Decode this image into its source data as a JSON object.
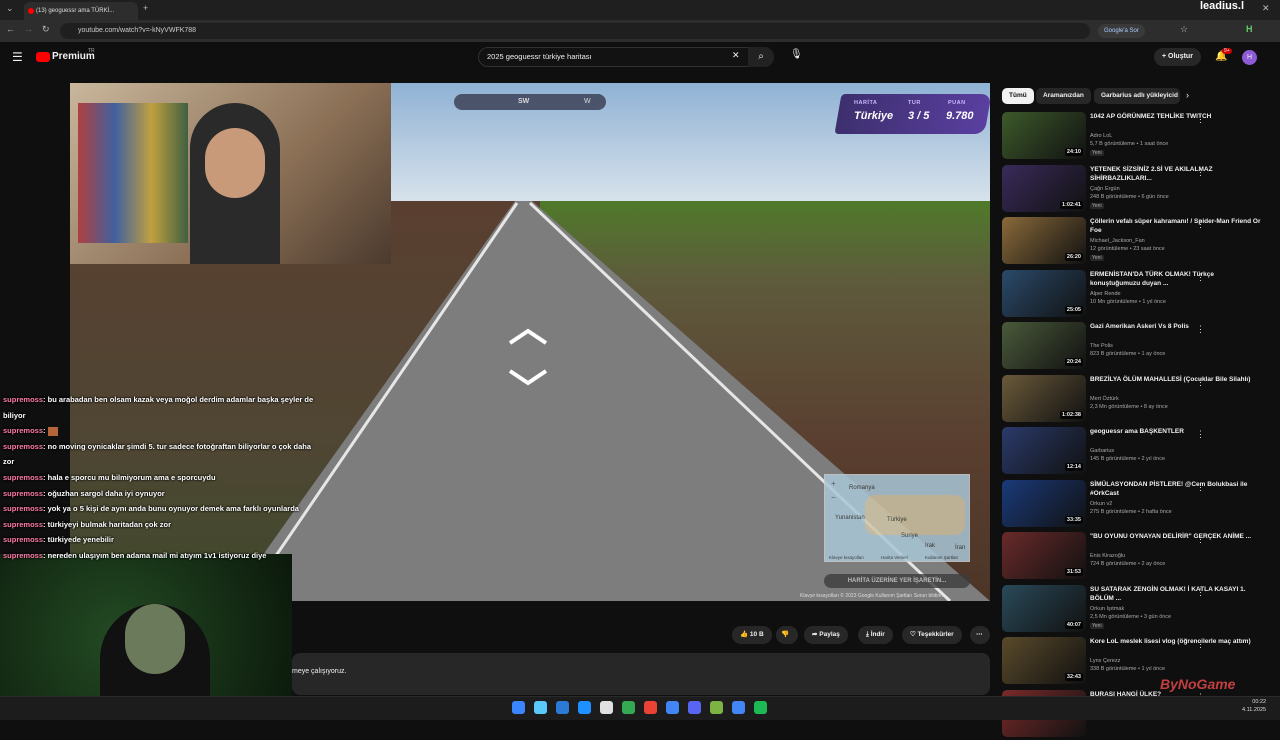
{
  "browser": {
    "tab_title": "(13) geoguessr ama TÜRKİ...",
    "url": "youtube.com/watch?v=-kNyVWFK788",
    "google_sor": "Google'a Sor",
    "profile_letter": "H"
  },
  "youtube": {
    "logo_text": "Premium",
    "logo_sup": "TR",
    "search_query": "2025 geoguessr türkiye haritası",
    "create_label": "Oluştur",
    "notif_count": "9+",
    "avatar_letter": "H"
  },
  "watermark_top": "leadius.l",
  "video": {
    "compass_label": "SW",
    "compass_w": "W",
    "score": {
      "harita_label": "HARİTA",
      "harita_value": "Türkiye",
      "tur_label": "TUR",
      "tur_value": "3 / 5",
      "puan_label": "PUAN",
      "puan_value": "9.780"
    },
    "minimap": {
      "labels": [
        "Romanya",
        "Yunanistan",
        "Türkiye",
        "Suriye",
        "Irak",
        "İran"
      ],
      "footer": [
        "Klavye kısayolları",
        "Harita Verileri",
        "Kullanım Şartları"
      ]
    },
    "map_button": "HARİTA ÜZERİNE YER İŞARETİN...",
    "footer": "Klavye kısayolları   © 2023 Google   Kullanım Şartları   Sorun bildirin"
  },
  "chat": [
    {
      "user": "supremoss",
      "text": ": bu arabadan ben olsam kazak veya moğol derdim adamlar başka şeyler de biliyor"
    },
    {
      "user": "supremoss",
      "text": ": "
    },
    {
      "user": "supremoss",
      "text": ": no moving oynicaklar şimdi 5. tur sadece fotoğraftan biliyorlar o çok daha zor"
    },
    {
      "user": "supremoss",
      "text": ": hala e sporcu mu bilmiyorum ama e sporcuydu"
    },
    {
      "user": "supremoss",
      "text": ": oğuzhan sargol daha iyi oynuyor"
    },
    {
      "user": "supremoss",
      "text": ": yok ya o 5 kişi de aynı anda bunu oynuyor demek ama farklı oyunlarda"
    },
    {
      "user": "supremoss",
      "text": ": türkiyeyi bulmak haritadan çok zor"
    },
    {
      "user": "supremoss",
      "text": ": türkiyede yenebilir"
    },
    {
      "user": "supremoss",
      "text": ": nereden ulaşıyım ben adama mail mi atıyım 1v1 istiyoruz diye"
    }
  ],
  "actions": {
    "like_count": "10 B",
    "share": "Paylaş",
    "download": "İndir",
    "thanks": "Teşekkürler"
  },
  "description_snippet": "meye çalışıyoruz.",
  "chips": [
    "Tümü",
    "Aramanızdan",
    "Garbarius adlı yükleyicid"
  ],
  "recommendations": [
    {
      "title": "1042 AP GÖRÜNMEZ TEHLİKE TWITCH",
      "channel": "Adro LoL",
      "meta": "5,7 B görüntüleme • 1 saat önce",
      "badge": "Yeni",
      "duration": "24:10",
      "color": "#3d5a2a"
    },
    {
      "title": "YETENEK SİZSİNİZ 2.Sİ VE AKILALMAZ SİHİRBAZLIKLARI...",
      "channel": "Çağrı Ergün",
      "meta": "248 B görüntüleme • 6 gün önce",
      "badge": "Yeni",
      "duration": "1:02:41",
      "color": "#3a2a5a"
    },
    {
      "title": "Çöllerin vefalı süper kahramanı! / Spider-Man Friend Or Foe",
      "channel": "Michael_Jackson_Fan",
      "meta": "12 görüntüleme • 23 saat önce",
      "badge": "Yeni",
      "duration": "26:20",
      "color": "#8a6a3a"
    },
    {
      "title": "ERMENİSTAN'DA TÜRK OLMAK! Türkçe konuştuğumuzu duyan ...",
      "channel": "Alper Rende",
      "meta": "10 Mn görüntüleme • 1 yıl önce",
      "badge": "",
      "duration": "25:05",
      "color": "#2a4a6a"
    },
    {
      "title": "Gazi Amerikan Askeri Vs 8 Polis",
      "channel": "The Polis",
      "meta": "823 B görüntüleme • 1 ay önce",
      "badge": "",
      "duration": "20:24",
      "color": "#4a5a3a"
    },
    {
      "title": "BREZİLYA ÖLÜM MAHALLESİ (Çocuklar Bile Silahlı) ",
      "channel": "Mert Öztürk",
      "meta": "2,3 Mn görüntüleme • 8 ay önce",
      "badge": "",
      "duration": "1:02:38",
      "color": "#6a5a3a"
    },
    {
      "title": "geoguessr ama BAŞKENTLER",
      "channel": "Garbarius",
      "meta": "145 B görüntüleme • 2 yıl önce",
      "badge": "",
      "duration": "12:14",
      "color": "#2a3a6a"
    },
    {
      "title": "SİMÜLASYONDAN PİSTLERE! @Cem Bolukbasi ile #OrkCast",
      "channel": "Orkun v2",
      "meta": "275 B görüntüleme • 2 hafta önce",
      "badge": "",
      "duration": "33:35",
      "color": "#1a3a7a"
    },
    {
      "title": "\"BU OYUNU OYNAYAN DELİRİR\" GERÇEK ANİME ...",
      "channel": "Enis Kirazoğlu",
      "meta": "724 B görüntüleme • 2 ay önce",
      "badge": "",
      "duration": "31:53",
      "color": "#6a2a2a"
    },
    {
      "title": "SU SATARAK ZENGİN OLMAK! İ KATLA KASAYI 1. BÖLÜM ...",
      "channel": "Orkun Işıtmak",
      "meta": "2,5 Mn görüntüleme • 3 gün önce",
      "badge": "Yeni",
      "duration": "40:07",
      "color": "#2a4a5a"
    },
    {
      "title": "Kore LoL meslek lisesi vlog (öğrencilerle maç attım)",
      "channel": "Lynx Çerezz",
      "meta": "338 B görüntüleme • 1 yıl önce",
      "badge": "",
      "duration": "32:43",
      "color": "#5a4a2a"
    },
    {
      "title": "BURASI HANGİ ÜLKE?",
      "channel": "",
      "meta": "",
      "badge": "",
      "duration": "",
      "color": "#7a2a2a"
    }
  ],
  "taskbar": {
    "time": "00:22",
    "date": "4.11.2025"
  },
  "watermark_bottom": "ByNoGame"
}
